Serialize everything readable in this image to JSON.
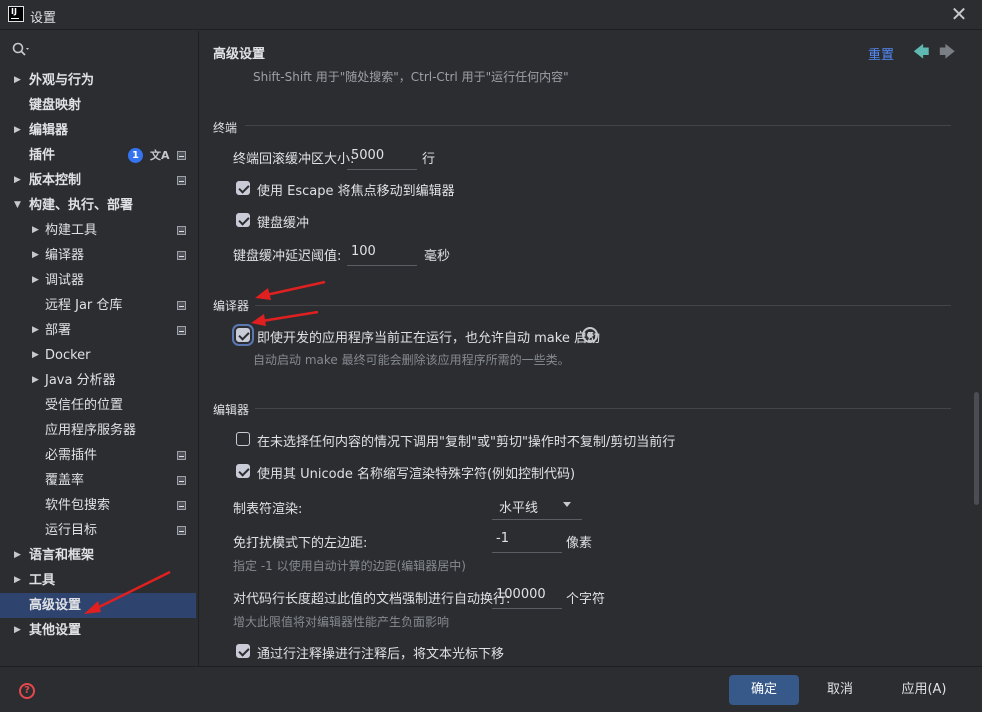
{
  "window": {
    "title": "设置",
    "close": "✕"
  },
  "sidebar": {
    "items": [
      {
        "label": "外观与行为",
        "expanded": false,
        "has_arrow": true
      },
      {
        "label": "键盘映射"
      },
      {
        "label": "编辑器",
        "has_arrow": true
      },
      {
        "label": "插件",
        "badge": "1"
      },
      {
        "label": "版本控制",
        "has_arrow": true
      },
      {
        "label": "构建、执行、部署",
        "has_arrow": true,
        "expanded": true
      },
      {
        "label": "构建工具",
        "has_arrow": true
      },
      {
        "label": "编译器",
        "has_arrow": true
      },
      {
        "label": "调试器",
        "has_arrow": true
      },
      {
        "label": "远程 Jar 仓库"
      },
      {
        "label": "部署",
        "has_arrow": true
      },
      {
        "label": "Docker",
        "has_arrow": true
      },
      {
        "label": "Java 分析器",
        "has_arrow": true
      },
      {
        "label": "受信任的位置"
      },
      {
        "label": "应用程序服务器"
      },
      {
        "label": "必需插件"
      },
      {
        "label": "覆盖率"
      },
      {
        "label": "软件包搜索"
      },
      {
        "label": "运行目标"
      },
      {
        "label": "语言和框架",
        "has_arrow": true
      },
      {
        "label": "工具",
        "has_arrow": true
      },
      {
        "label": "高级设置",
        "selected": true
      },
      {
        "label": "其他设置",
        "has_arrow": true
      }
    ]
  },
  "content": {
    "title": "高级设置",
    "subtitle": "Shift-Shift 用于\"随处搜索\"，Ctrl-Ctrl 用于\"运行任何内容\"",
    "reset": "重置",
    "sections": {
      "terminal": {
        "title": "终端",
        "scroll_label": "终端回滚缓冲区大小:",
        "scroll_value": "5000",
        "scroll_unit": "行",
        "escape_label": "使用 Escape 将焦点移动到编辑器",
        "escape_checked": true,
        "buffer_label": "键盘缓冲",
        "buffer_checked": true,
        "delay_label": "键盘缓冲延迟阈值:",
        "delay_value": "100",
        "delay_unit": "毫秒"
      },
      "compiler": {
        "title": "编译器",
        "auto_make_label": "即使开发的应用程序当前正在运行，也允许自动 make 启动",
        "auto_make_checked": true,
        "auto_make_hint": "自动启动 make 最终可能会删除该应用程序所需的一些类。"
      },
      "editor": {
        "title": "编辑器",
        "copy_label": "在未选择任何内容的情况下调用\"复制\"或\"剪切\"操作时不复制/剪切当前行",
        "copy_checked": false,
        "unicode_label": "使用其 Unicode 名称缩写渲染特殊字符(例如控制代码)",
        "unicode_checked": true,
        "tab_label": "制表符渲染:",
        "tab_value": "水平线",
        "margin_label": "免打扰模式下的左边距:",
        "margin_value": "-1",
        "margin_unit": "像素",
        "margin_hint": "指定 -1 以使用自动计算的边距(编辑器居中)",
        "wrap_label": "对代码行长度超过此值的文档强制进行自动换行:",
        "wrap_value": "100000",
        "wrap_unit": "个字符",
        "wrap_hint": "增大此限值将对编辑器性能产生负面影响",
        "comment_label": "通过行注释操进行注释后，将文本光标下移",
        "comment_checked": true
      }
    }
  },
  "footer": {
    "ok": "确定",
    "cancel": "取消",
    "apply": "应用(A)"
  },
  "colors": {
    "accent": "#37598a",
    "annotation_arrow": "#e02020",
    "link": "#548af7"
  }
}
